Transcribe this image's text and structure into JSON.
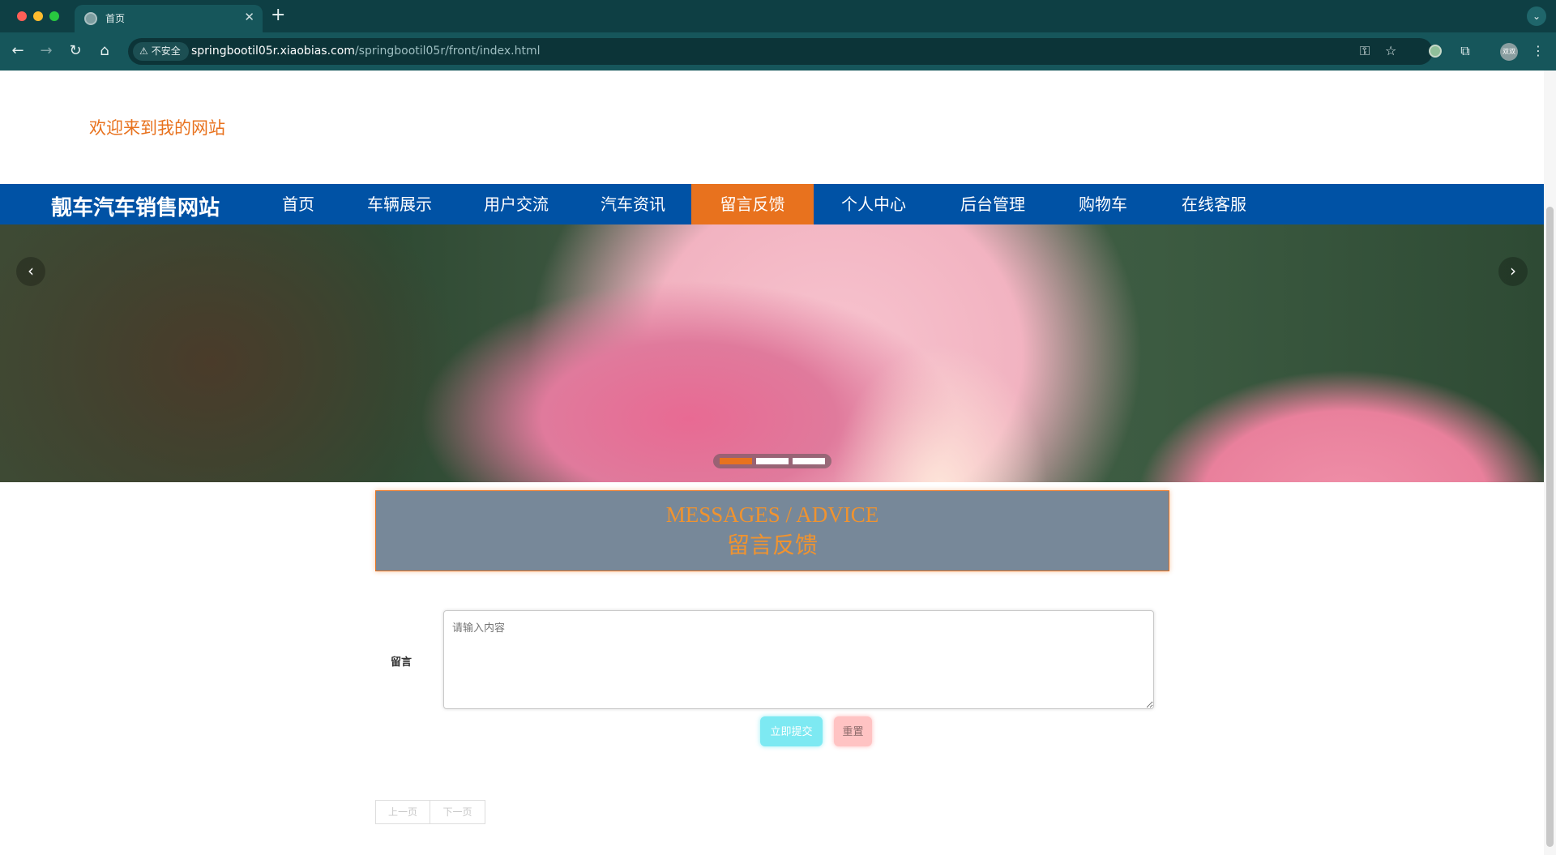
{
  "browser": {
    "tab_title": "首页",
    "tab_close": "✕",
    "new_tab": "+",
    "tab_menu": "⌄",
    "security_label": "不安全",
    "url_host": "springbootil05r.xiaobias.com",
    "url_path": "/springbootil05r/front/index.html",
    "back_icon": "←",
    "forward_icon": "→",
    "reload_icon": "↻",
    "home_icon": "⌂",
    "key_icon": "⚿",
    "star_icon": "☆",
    "extensions_icon": "⧉",
    "menu_icon": "⋮",
    "avatar_text": "双双"
  },
  "site": {
    "welcome": "欢迎来到我的网站",
    "brand": "靓车汽车销售网站"
  },
  "nav": {
    "items": [
      {
        "label": "首页",
        "active": false
      },
      {
        "label": "车辆展示",
        "active": false
      },
      {
        "label": "用户交流",
        "active": false
      },
      {
        "label": "汽车资讯",
        "active": false
      },
      {
        "label": "留言反馈",
        "active": true
      },
      {
        "label": "个人中心",
        "active": false
      },
      {
        "label": "后台管理",
        "active": false
      },
      {
        "label": "购物车",
        "active": false
      },
      {
        "label": "在线客服",
        "active": false
      }
    ]
  },
  "carousel": {
    "prev_icon": "‹",
    "next_icon": "›",
    "slide_count": 3,
    "active_index": 0
  },
  "section": {
    "title_en": "MESSAGES / ADVICE",
    "title_cn": "留言反馈"
  },
  "form": {
    "label": "留言",
    "placeholder": "请输入内容",
    "value": "",
    "submit_label": "立即提交",
    "reset_label": "重置"
  },
  "pager": {
    "prev_label": "上一页",
    "next_label": "下一页"
  },
  "colors": {
    "nav_bg": "#0052a5",
    "accent": "#e8721e",
    "header_bg": "#778899",
    "submit_bg": "#7de9f2",
    "reset_bg": "#ffc3c3"
  }
}
